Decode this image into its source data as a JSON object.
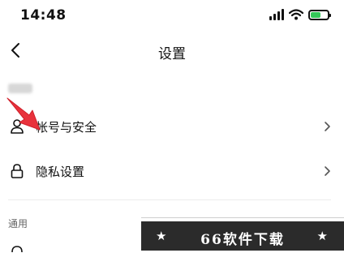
{
  "status_bar": {
    "time": "14:48",
    "icons": [
      "signal-icon",
      "wifi-icon",
      "battery-charging-icon"
    ]
  },
  "nav": {
    "title": "设置",
    "back_icon": "chevron-left-icon"
  },
  "account_name": "",
  "settings": [
    {
      "label": "帐号与安全",
      "icon": "user-icon"
    },
    {
      "label": "隐私设置",
      "icon": "lock-icon"
    }
  ],
  "section": {
    "label": "通用"
  },
  "overlay": {
    "arrow_color": "#e8323c",
    "watermark_text": "66软件下载",
    "watermark_star": "★"
  },
  "colors": {
    "battery_fill": "#34c759",
    "watermark_bg": "#2b2b2b"
  }
}
